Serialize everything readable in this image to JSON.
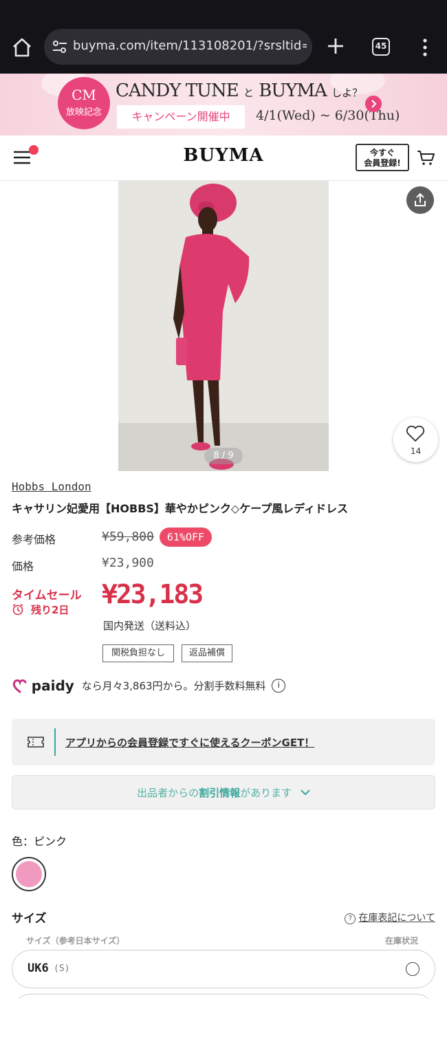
{
  "browser": {
    "url": "buyma.com/item/113108201/?srsltid=AfmB",
    "tab_count": "45"
  },
  "banner": {
    "cm_line1": "CM",
    "cm_line2": "放映記念",
    "headline_a": "CANDY TUNE",
    "headline_and": "と",
    "headline_b": "BUYMA",
    "headline_tail": "しよ？",
    "campaign": "キャンペーン開催中",
    "dates": "4/1(Wed) ~ 6/30(Thu)"
  },
  "header": {
    "logo": "BUYMA",
    "register_line1": "今すぐ",
    "register_line2": "会員登録!"
  },
  "gallery": {
    "counter": "8 / 9",
    "favorite_count": "14"
  },
  "product": {
    "brand": "Hobbs London",
    "title": "キャサリン妃愛用【HOBBS】華やかピンク◇ケープ風レディドレス",
    "ref_price_label": "参考価格",
    "ref_price": "¥59,800",
    "discount_badge": "61%OFF",
    "price_label": "価格",
    "price": "¥23,900",
    "sale_label": "タイムセール",
    "sale_remaining": "残り2日",
    "sale_price": "¥23,183",
    "shipping": "国内発送（送料込）",
    "tags": [
      "関税負担なし",
      "返品補償"
    ]
  },
  "paidy": {
    "brand": "paidy",
    "text": "なら月々3,863円から。分割手数料無料"
  },
  "coupon": {
    "text": "アプリからの会員登録ですぐに使えるクーポンGET！"
  },
  "discount_info": {
    "prefix": "出品者からの",
    "bold": "割引情報",
    "suffix": "があります"
  },
  "color": {
    "label": "色：ピンク",
    "swatch": "#f09ac0"
  },
  "size": {
    "title": "サイズ",
    "stock_link": "在庫表記について",
    "col_size": "サイズ（参考日本サイズ）",
    "col_stock": "在庫状況",
    "rows": [
      {
        "size": "UK6",
        "jp": "(S)"
      }
    ]
  },
  "colors": {
    "accent": "#d8314a",
    "badge": "#ee4a68",
    "teal": "#3aa6a0",
    "banner_pink": "#e9457d"
  }
}
